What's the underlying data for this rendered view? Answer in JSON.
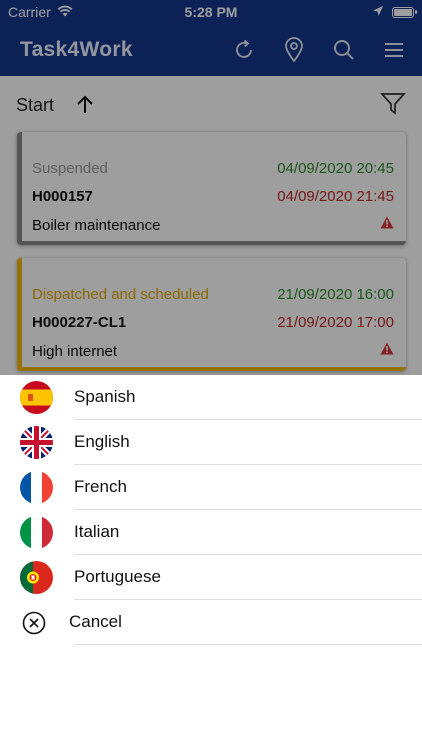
{
  "statusbar": {
    "carrier": "Carrier",
    "time": "5:28 PM"
  },
  "navbar": {
    "title": "Task4Work"
  },
  "sort": {
    "label": "Start"
  },
  "tasks": [
    {
      "status": "Suspended",
      "status_color": "#9a9a9a",
      "accent": "#8a8a8a",
      "code": "H000157",
      "description": "Boiler maintenance",
      "start": "04/09/2020 20:45",
      "end": "04/09/2020 21:45"
    },
    {
      "status": "Dispatched and scheduled",
      "status_color": "#e0a800",
      "accent": "#f2b705",
      "code": "H000227-CL1",
      "description": "High internet",
      "start": "21/09/2020 16:00",
      "end": "21/09/2020 17:00"
    }
  ],
  "languages": [
    {
      "label": "Spanish",
      "flag": "spain-flag"
    },
    {
      "label": "English",
      "flag": "uk-flag"
    },
    {
      "label": "French",
      "flag": "france-flag"
    },
    {
      "label": "Italian",
      "flag": "italy-flag"
    },
    {
      "label": "Portuguese",
      "flag": "portugal-flag"
    }
  ],
  "cancel_label": "Cancel",
  "colors": {
    "brand": "#14378c",
    "date_start": "#2e8b2e",
    "date_end": "#c0282a"
  }
}
